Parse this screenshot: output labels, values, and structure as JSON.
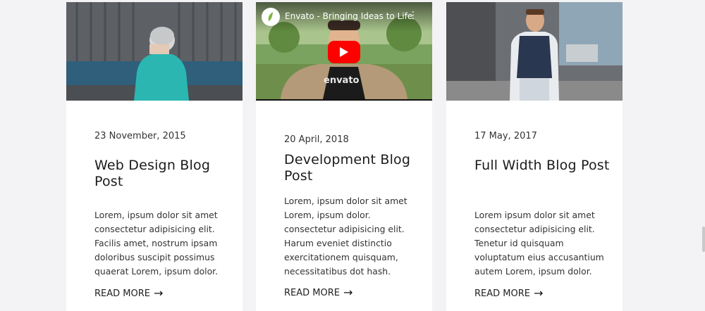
{
  "cards": [
    {
      "date": "23 November, 2015",
      "title": "Web Design Blog Post",
      "excerpt": "Lorem, ipsum dolor sit amet consectetur adipisicing elit. Facilis amet, nostrum ipsam doloribus suscipit possimus quaerat Lorem, ipsum dolor.",
      "read_more": "READ MORE",
      "image": "woman-in-teal-jacket-photo"
    },
    {
      "date": "20 April, 2018",
      "title": "Development Blog Post",
      "excerpt": "Lorem, ipsum dolor sit amet Lorem, ipsum dolor. consectetur adipisicing elit. Harum eveniet distinctio exercitationem quisquam, necessitatibus dot hash.",
      "read_more": "READ MORE",
      "video": {
        "title": "Envato - Bringing Ideas to Life",
        "overlay_brand": "envato"
      }
    },
    {
      "date": "17 May, 2017",
      "title": "Full Width Blog Post",
      "excerpt": "Lorem ipsum dolor sit amet consectetur adipisicing elit. Tenetur id quisquam voluptatum eius accusantium autem Lorem, ipsum dolor.",
      "read_more": "READ MORE",
      "image": "man-in-vest-street-photo"
    }
  ],
  "colors": {
    "page_bg": "#f3f2f4",
    "card_bg": "#ffffff",
    "youtube_red": "#ff0000",
    "teal_jacket": "#2bb6b2"
  }
}
